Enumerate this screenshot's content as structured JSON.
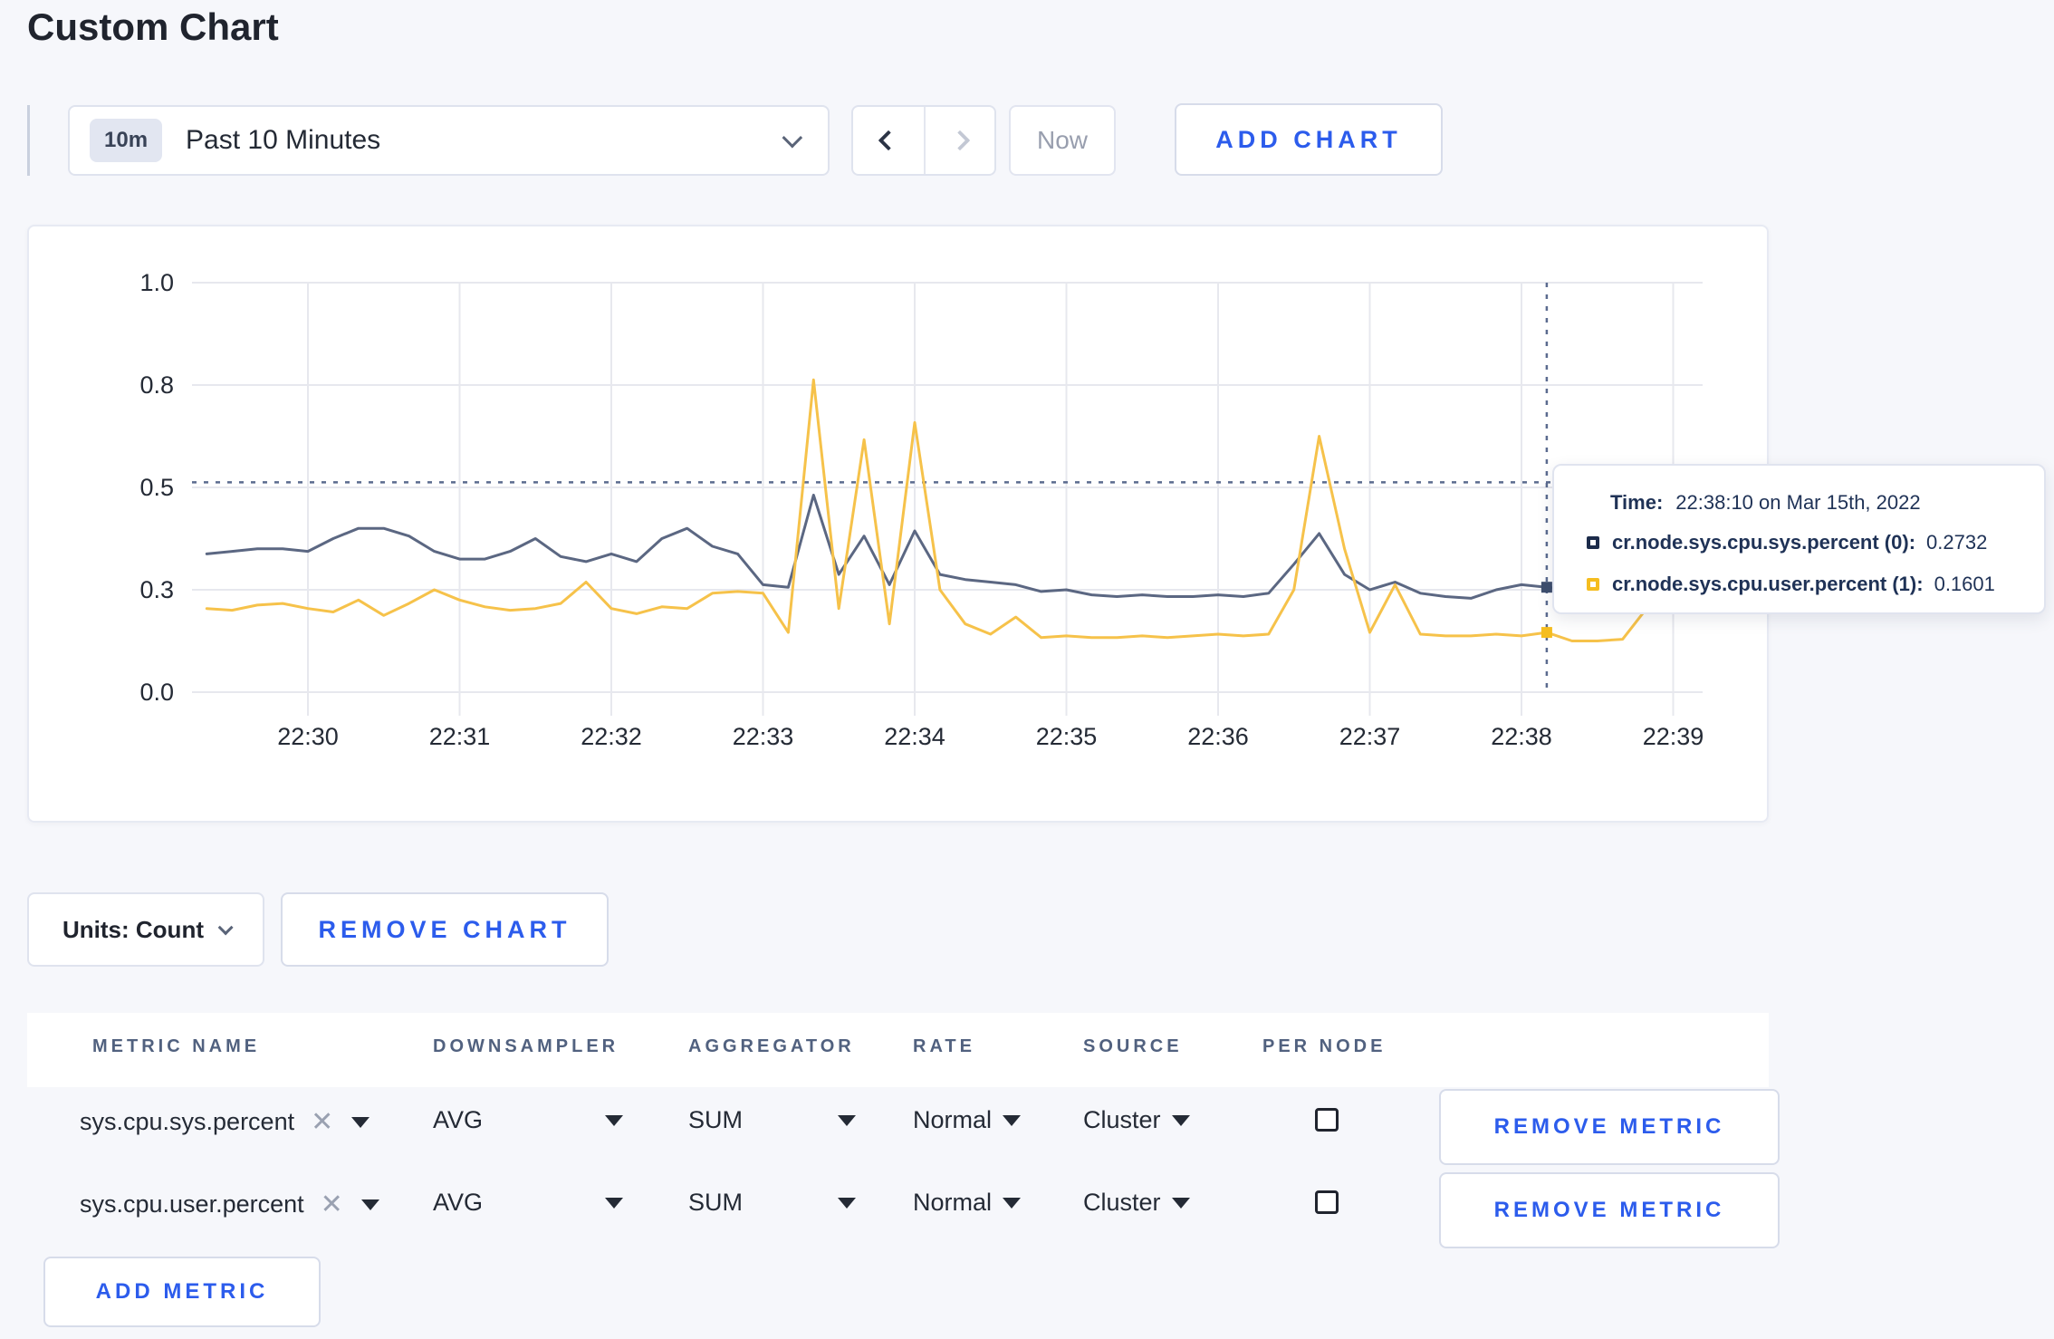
{
  "page": {
    "title": "Custom Chart"
  },
  "toolbar": {
    "time_range_badge": "10m",
    "time_range_label": "Past 10 Minutes",
    "now_label": "Now",
    "add_chart_label": "ADD CHART"
  },
  "tooltip": {
    "time_label": "Time:",
    "time_value": "22:38:10 on Mar 15th, 2022",
    "rows": [
      {
        "label": "cr.node.sys.cpu.sys.percent (0):",
        "value": "0.2732",
        "color": "#1c2b4a"
      },
      {
        "label": "cr.node.sys.cpu.user.percent (1):",
        "value": "0.1601",
        "color": "#f5bd1f"
      }
    ]
  },
  "chart_footer": {
    "units_label": "Units: Count",
    "remove_chart_label": "REMOVE CHART"
  },
  "metrics_table": {
    "headers": [
      "METRIC NAME",
      "DOWNSAMPLER",
      "AGGREGATOR",
      "RATE",
      "SOURCE",
      "PER NODE"
    ],
    "rows": [
      {
        "metric": "sys.cpu.sys.percent",
        "downsampler": "AVG",
        "aggregator": "SUM",
        "rate": "Normal",
        "source": "Cluster",
        "per_node_checked": false,
        "remove_label": "REMOVE METRIC"
      },
      {
        "metric": "sys.cpu.user.percent",
        "downsampler": "AVG",
        "aggregator": "SUM",
        "rate": "Normal",
        "source": "Cluster",
        "per_node_checked": false,
        "remove_label": "REMOVE METRIC"
      }
    ],
    "add_metric_label": "ADD METRIC"
  },
  "chart_data": {
    "type": "line",
    "title": "",
    "xlabel": "",
    "ylabel": "",
    "ylim": [
      0,
      1
    ],
    "grid": true,
    "legend_position": "tooltip",
    "y_ticks": [
      {
        "label": "1.0",
        "value": 1.0
      },
      {
        "label": "0.8",
        "value": 0.8
      },
      {
        "label": "0.5",
        "value": 0.5
      },
      {
        "label": "0.3",
        "value": 0.3
      },
      {
        "label": "0.0",
        "value": 0.0
      }
    ],
    "x_ticks": [
      "22:30",
      "22:31",
      "22:32",
      "22:33",
      "22:34",
      "22:35",
      "22:36",
      "22:37",
      "22:38",
      "22:39"
    ],
    "x": [
      "22:29:20",
      "22:29:30",
      "22:29:40",
      "22:29:50",
      "22:30:00",
      "22:30:10",
      "22:30:20",
      "22:30:30",
      "22:30:40",
      "22:30:50",
      "22:31:00",
      "22:31:10",
      "22:31:20",
      "22:31:30",
      "22:31:40",
      "22:31:50",
      "22:32:00",
      "22:32:10",
      "22:32:20",
      "22:32:30",
      "22:32:40",
      "22:32:50",
      "22:33:00",
      "22:33:10",
      "22:33:20",
      "22:33:30",
      "22:33:40",
      "22:33:50",
      "22:34:00",
      "22:34:10",
      "22:34:20",
      "22:34:30",
      "22:34:40",
      "22:34:50",
      "22:35:00",
      "22:35:10",
      "22:35:20",
      "22:35:30",
      "22:35:40",
      "22:35:50",
      "22:36:00",
      "22:36:10",
      "22:36:20",
      "22:36:30",
      "22:36:40",
      "22:36:50",
      "22:37:00",
      "22:37:10",
      "22:37:20",
      "22:37:30",
      "22:37:40",
      "22:37:50",
      "22:38:00",
      "22:38:10",
      "22:38:20",
      "22:38:30",
      "22:38:40",
      "22:38:50",
      "22:39:00",
      "22:39:10"
    ],
    "series": [
      {
        "name": "cr.node.sys.cpu.sys.percent (0)",
        "color": "#5b6782",
        "dot_color": "#3e4f6e",
        "values": [
          0.37,
          0.375,
          0.38,
          0.38,
          0.375,
          0.4,
          0.42,
          0.42,
          0.405,
          0.375,
          0.36,
          0.36,
          0.375,
          0.4,
          0.365,
          0.355,
          0.37,
          0.355,
          0.4,
          0.42,
          0.385,
          0.37,
          0.31,
          0.305,
          0.485,
          0.33,
          0.405,
          0.31,
          0.415,
          0.33,
          0.32,
          0.315,
          0.31,
          0.295,
          0.3,
          0.285,
          0.28,
          0.285,
          0.28,
          0.28,
          0.285,
          0.28,
          0.29,
          0.35,
          0.41,
          0.33,
          0.3,
          0.315,
          0.29,
          0.28,
          0.275,
          0.3,
          0.31,
          0.305,
          0.3,
          0.285,
          0.275,
          0.28,
          0.315,
          0.3
        ]
      },
      {
        "name": "cr.node.sys.cpu.user.percent (1)",
        "color": "#f6c24a",
        "dot_color": "#f5bd1f",
        "values": [
          0.245,
          0.24,
          0.255,
          0.26,
          0.245,
          0.235,
          0.27,
          0.225,
          0.26,
          0.3,
          0.27,
          0.25,
          0.24,
          0.245,
          0.26,
          0.315,
          0.245,
          0.23,
          0.25,
          0.245,
          0.29,
          0.295,
          0.29,
          0.175,
          0.81,
          0.245,
          0.64,
          0.2,
          0.69,
          0.3,
          0.2,
          0.17,
          0.22,
          0.16,
          0.165,
          0.16,
          0.16,
          0.165,
          0.16,
          0.165,
          0.17,
          0.165,
          0.17,
          0.3,
          0.65,
          0.38,
          0.175,
          0.31,
          0.17,
          0.165,
          0.165,
          0.17,
          0.165,
          0.175,
          0.15,
          0.15,
          0.155,
          0.25,
          0.28,
          0.24
        ]
      }
    ],
    "threshold_guideline": 0.515,
    "crosshair": {
      "index": 53,
      "time": "22:38:10"
    },
    "colors": {
      "grid": "#e7e8ee",
      "dashed": "#5b6b8f"
    }
  }
}
